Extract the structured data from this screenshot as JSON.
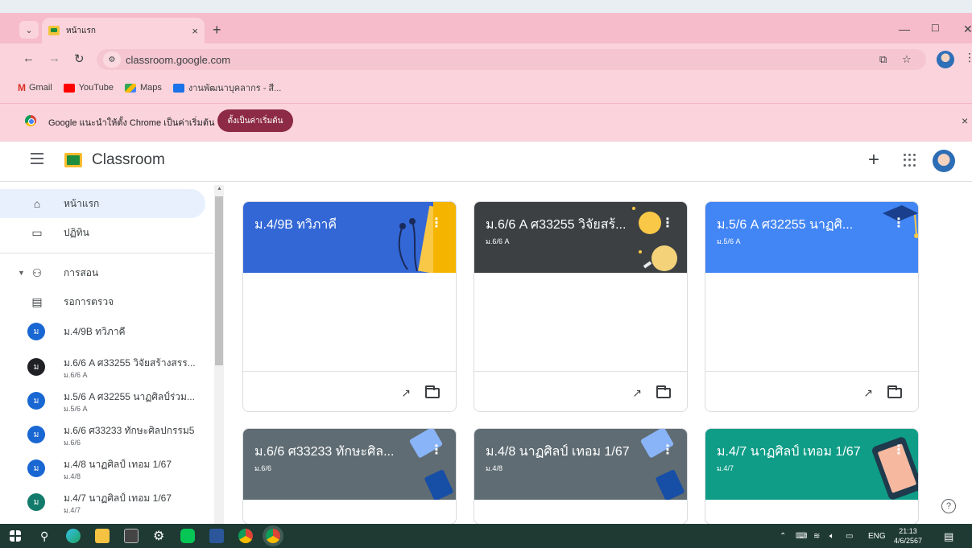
{
  "browser": {
    "tab_title": "หน้าแรก",
    "tab_close": "×",
    "new_tab": "+",
    "url": "classroom.google.com",
    "bookmarks": [
      "Gmail",
      "YouTube",
      "Maps",
      "งานพัฒนาบุคลากร - สี..."
    ],
    "infobar_text": "Google แนะนำให้ตั้ง Chrome เป็นค่าเริ่มต้น",
    "infobar_button": "ตั้งเป็นค่าเริ่มต้น",
    "infobar_close": "×"
  },
  "header": {
    "title": "Classroom",
    "plus": "+"
  },
  "sidebar": {
    "home": "หน้าแรก",
    "calendar": "ปฏิทิน",
    "teaching": "การสอน",
    "to_review": "รอการตรวจ",
    "classes": [
      {
        "avatar": "ม",
        "name": "ม.4/9B ทวิภาคี",
        "section": "",
        "color": "#1967d2"
      },
      {
        "avatar": "ม",
        "name": "ม.6/6 A ศ33255 วิจัยสร้างสรร...",
        "section": "ม.6/6 A",
        "color": "#202124"
      },
      {
        "avatar": "ม",
        "name": "ม.5/6 A ศ32255 นาฏศิลป์ร่วม...",
        "section": "ม.5/6 A",
        "color": "#1967d2"
      },
      {
        "avatar": "ม",
        "name": "ม.6/6 ศ33233 ทักษะศิลปกรรม5",
        "section": "ม.6/6",
        "color": "#1967d2"
      },
      {
        "avatar": "ม",
        "name": "ม.4/8 นาฏศิลป์ เทอม 1/67",
        "section": "ม.4/8",
        "color": "#1967d2"
      },
      {
        "avatar": "ม",
        "name": "ม.4/7 นาฏศิลป์ เทอม 1/67",
        "section": "ม.4/7",
        "color": "#137b6b"
      }
    ]
  },
  "cards": [
    {
      "title": "ม.4/9B ทวิภาคี",
      "section": "",
      "color": "#3367d6"
    },
    {
      "title": "ม.6/6 A ศ33255 วิจัยสร้...",
      "section": "ม.6/6 A",
      "color": "#3c4043"
    },
    {
      "title": "ม.5/6 A ศ32255 นาฏศิ...",
      "section": "ม.5/6 A",
      "color": "#4285f4"
    },
    {
      "title": "ม.6/6 ศ33233 ทักษะศิล...",
      "section": "ม.6/6",
      "color": "#5f6c73"
    },
    {
      "title": "ม.4/8 นาฏศิลป์ เทอม 1/67",
      "section": "ม.4/8",
      "color": "#5f6c73"
    },
    {
      "title": "ม.4/7 นาฏศิลป์ เทอม 1/67",
      "section": "ม.4/7",
      "color": "#0f9d87"
    }
  ],
  "help": "?",
  "taskbar": {
    "lang": "ENG",
    "time": "21:13",
    "date": "4/6/2567"
  }
}
